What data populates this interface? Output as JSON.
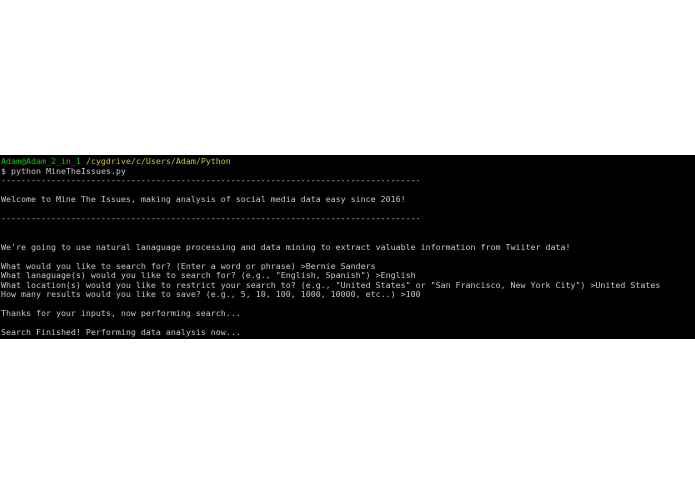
{
  "terminal": {
    "prompt_user": "Adam@Adam_2_in_1",
    "prompt_path": "/cygdrive/c/Users/Adam/Python",
    "command": "$ python MineTheIssues.py",
    "separator": "------------------------------------------------------------------------------------",
    "welcome": "Welcome to Mine The Issues, making analysis of social media data easy since 2016!",
    "intro": "We're going to use natural lanaguage processing and data mining to extract valuable information from Twiiter data!",
    "q1": "What would you like to search for? (Enter a word or phrase) >Bernie Sanders",
    "q2": "What lanaguage(s) would you like to search for? (e.g., \"English, Spanish\") >English",
    "q3": "What location(s) would you like to restrict your search to? (e.g., \"United States\" or \"San Francisco, New York City\") >United States",
    "q4": "How many results would you like to save? (e.g., 5, 10, 100, 1000, 10000, etc..) >100",
    "thanks": "Thanks for your inputs, now performing search...",
    "finished": "Search Finished! Performing data analysis now...",
    "colors": {
      "background": "#000000",
      "text": "#c8c8c8",
      "user": "#13c613",
      "path": "#c7c43a"
    }
  }
}
